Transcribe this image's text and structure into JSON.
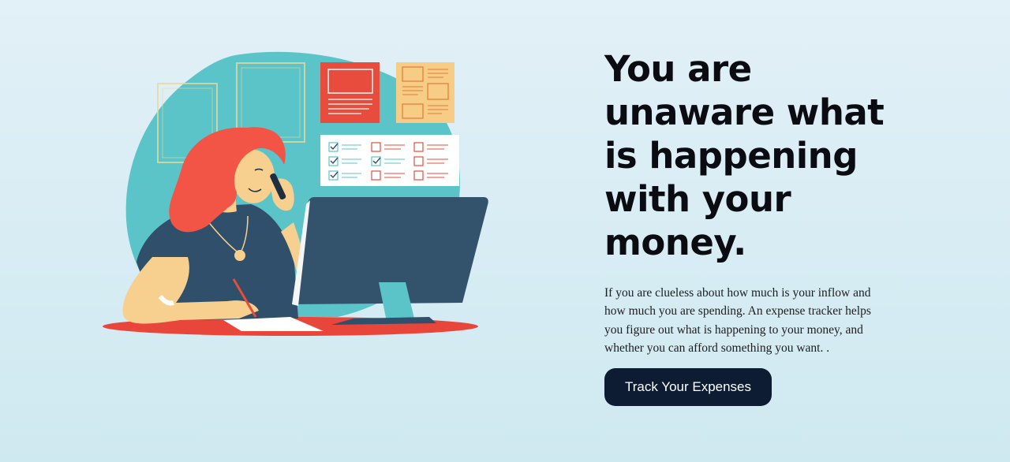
{
  "hero": {
    "headline": "You are unaware what is happening with your money.",
    "description": "If you are clueless about how much is your inflow and how much you are spending. An expense tracker helps you figure out what is happening to your money, and whether you can afford something you want. .",
    "cta_label": "Track Your Expenses"
  },
  "illustration": {
    "subject": "woman-on-phone-at-computer-writing-notes",
    "colors": {
      "blob": "#5bc4c9",
      "hair": "#f25545",
      "skin": "#f7cf8f",
      "shirt": "#2f4f6b",
      "monitor": "#33526b",
      "desk": "#e8453b",
      "note_red": "#e74c3c",
      "note_yellow": "#f7cd86"
    }
  },
  "theme": {
    "background_top": "#e2f0f7",
    "background_bottom": "#cfe9f1",
    "text_dark": "#0b0b12",
    "button_bg": "#0e1c33",
    "button_text": "#ffffff"
  }
}
